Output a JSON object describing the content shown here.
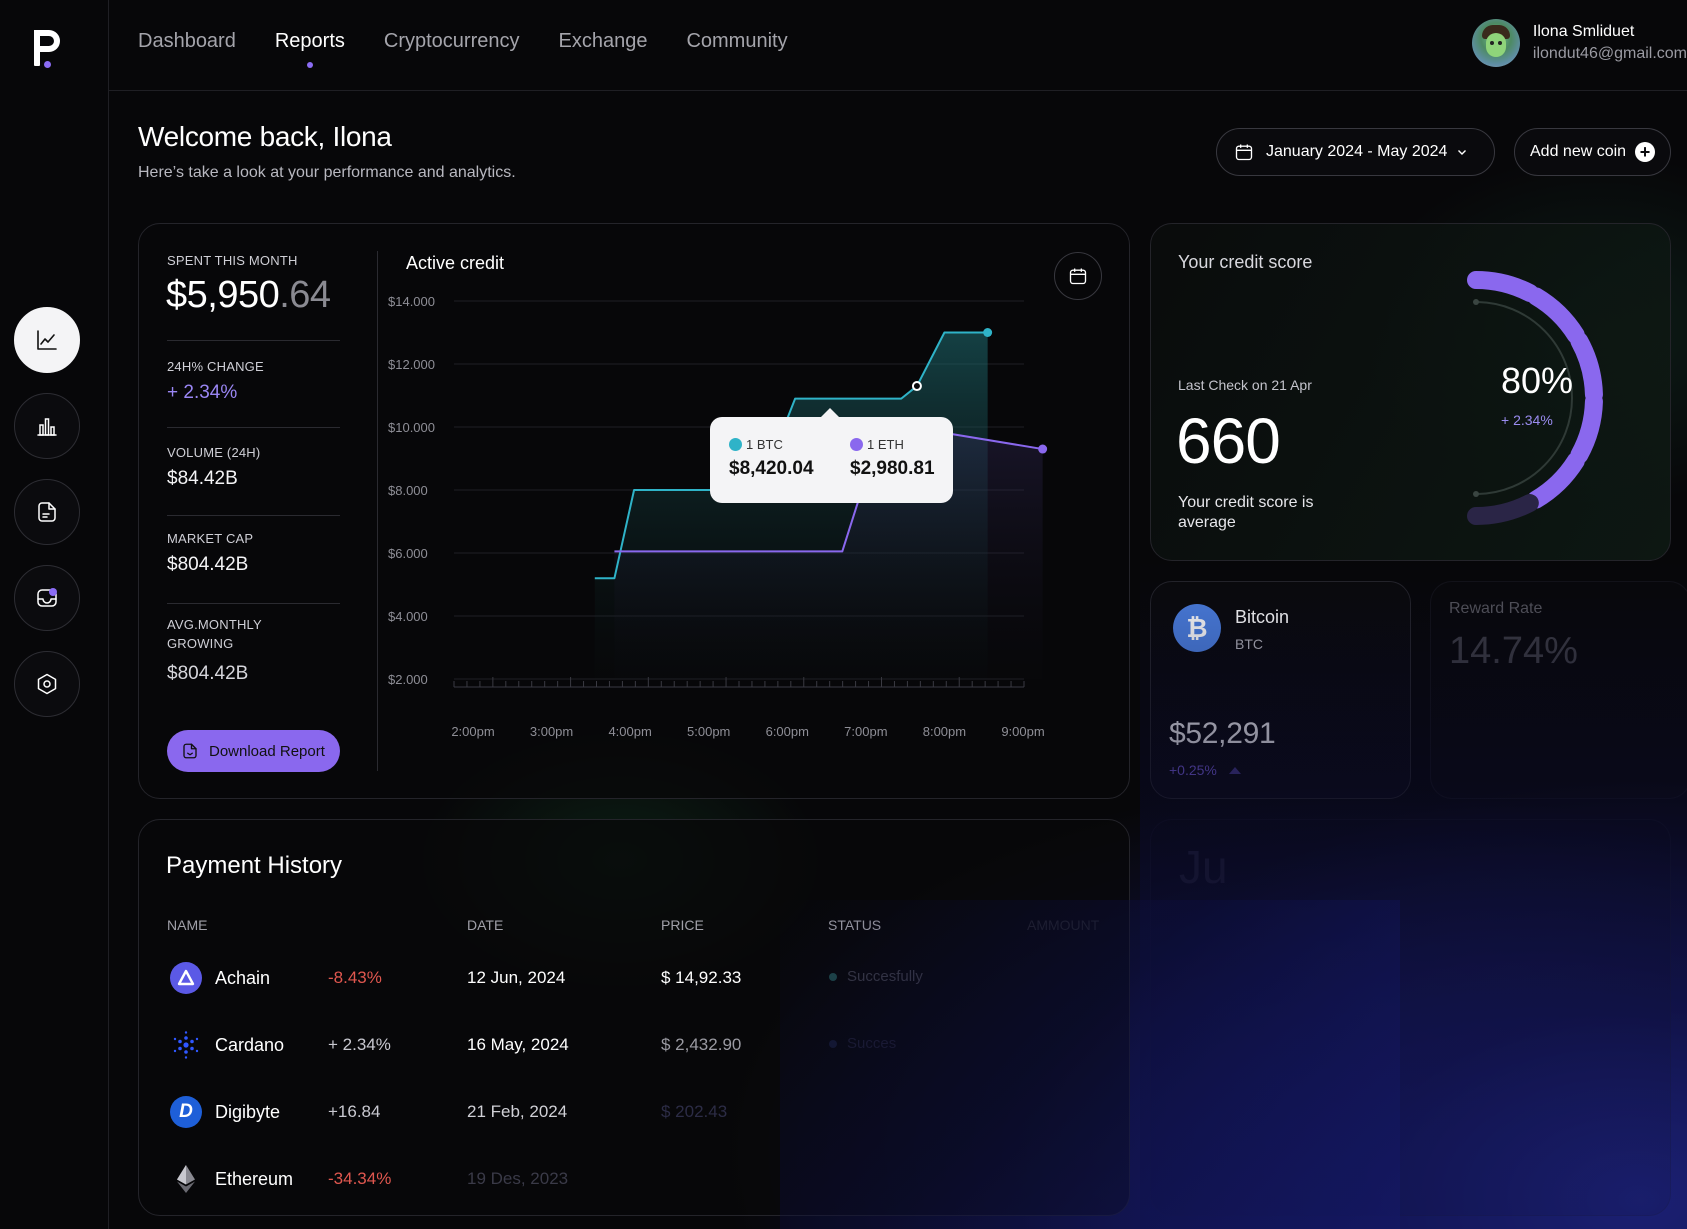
{
  "nav": {
    "links": [
      "Dashboard",
      "Reports",
      "Cryptocurrency",
      "Exchange",
      "Community"
    ],
    "active_index": 1
  },
  "user": {
    "name": "Ilona Smliduet",
    "email": "ilondut46@gmail.com"
  },
  "sidebar": {
    "icons": [
      "line-chart-icon",
      "bar-chart-icon",
      "document-icon",
      "inbox-icon",
      "hexagon-settings-icon"
    ],
    "active_index": 0
  },
  "header": {
    "title": "Welcome back, Ilona",
    "subtitle": "Here’s  take a look at your performance and analytics.",
    "date_range": "January 2024 - May 2024",
    "add_coin": "Add new coin"
  },
  "stats": {
    "spent_label": "SPENT THIS MONTH",
    "spent_main": "$5,950",
    "spent_dec": ".64",
    "change_label": "24H% CHANGE",
    "change_value": "+ 2.34%",
    "volume_label": "VOLUME (24H)",
    "volume_value": "$84.42B",
    "marketcap_label": "MARKET CAP",
    "marketcap_value": "$804.42B",
    "growing_label_1": "AVG.MONTHLY",
    "growing_label_2": "GROWING",
    "growing_value": "$804.42B",
    "download": "Download Report"
  },
  "chart": {
    "title": "Active credit",
    "tooltip": {
      "btc_label": "1 BTC",
      "btc_value": "$8,420.04",
      "eth_label": "1 ETH",
      "eth_value": "$2,980.81"
    }
  },
  "chart_data": {
    "type": "line",
    "title": "Active credit",
    "x": [
      "2:00pm",
      "3:00pm",
      "4:00pm",
      "5:00pm",
      "6:00pm",
      "7:00pm",
      "8:00pm",
      "9:00pm"
    ],
    "y_ticks": [
      "$14.000",
      "$12.000",
      "$10.000",
      "$8.000",
      "$6.000",
      "$4.000",
      "$2.000"
    ],
    "ylim": [
      2000,
      14000
    ],
    "series": [
      {
        "name": "1 BTC",
        "color": "#2fb3c8",
        "points": [
          [
            1.55,
            5200
          ],
          [
            1.8,
            5200
          ],
          [
            2.05,
            8000
          ],
          [
            3.4,
            8000
          ],
          [
            3.65,
            8050
          ],
          [
            4.1,
            10900
          ],
          [
            4.35,
            10900
          ],
          [
            5.45,
            10900
          ],
          [
            5.65,
            11300
          ],
          [
            6.0,
            13000
          ],
          [
            6.55,
            13000
          ]
        ]
      },
      {
        "name": "1 ETH",
        "color": "#8a68ee",
        "points": [
          [
            1.8,
            6050
          ],
          [
            4.7,
            6050
          ],
          [
            5.05,
            8800
          ],
          [
            5.55,
            10000
          ],
          [
            7.25,
            9300
          ]
        ]
      }
    ],
    "grid": true
  },
  "credit": {
    "title": "Your credit score",
    "last_check": "Last Check on 21 Apr",
    "score": "660",
    "desc": "Your credit score is average",
    "percent": "80%",
    "percent_value": 80,
    "change": "+ 2.34%"
  },
  "btc": {
    "name": "Bitcoin",
    "symbol": "BTC",
    "price": "$52,291",
    "change": "+0.25%"
  },
  "reward": {
    "label": "Reward Rate",
    "value": "14.74%"
  },
  "ghost": {
    "text": "Ju"
  },
  "payment": {
    "title": "Payment History",
    "columns": [
      "NAME",
      "DATE",
      "PRICE",
      "STATUS",
      "AMMOUNT"
    ],
    "rows": [
      {
        "name": "Achain",
        "change": "-8.43%",
        "date": "12 Jun, 2024",
        "price": "$ 14,92.33",
        "status": "Succesfully",
        "icon": "achain-icon",
        "color": "#5b59e6"
      },
      {
        "name": "Cardano",
        "change": "+ 2.34%",
        "date": "16 May, 2024",
        "price": "$ 2,432.90",
        "status": "Succes",
        "icon": "cardano-icon",
        "color": "#1b3bd0"
      },
      {
        "name": "Digibyte",
        "change": "+16.84",
        "date": "21 Feb, 2024",
        "price": "$ 202.43",
        "status": "",
        "icon": "digibyte-icon",
        "color": "#1e5fd8"
      },
      {
        "name": "Ethereum",
        "change": "-34.34%",
        "date": "19 Des, 2023",
        "price": "",
        "status": "",
        "icon": "ethereum-icon",
        "color": "#2a2a2f"
      }
    ]
  }
}
